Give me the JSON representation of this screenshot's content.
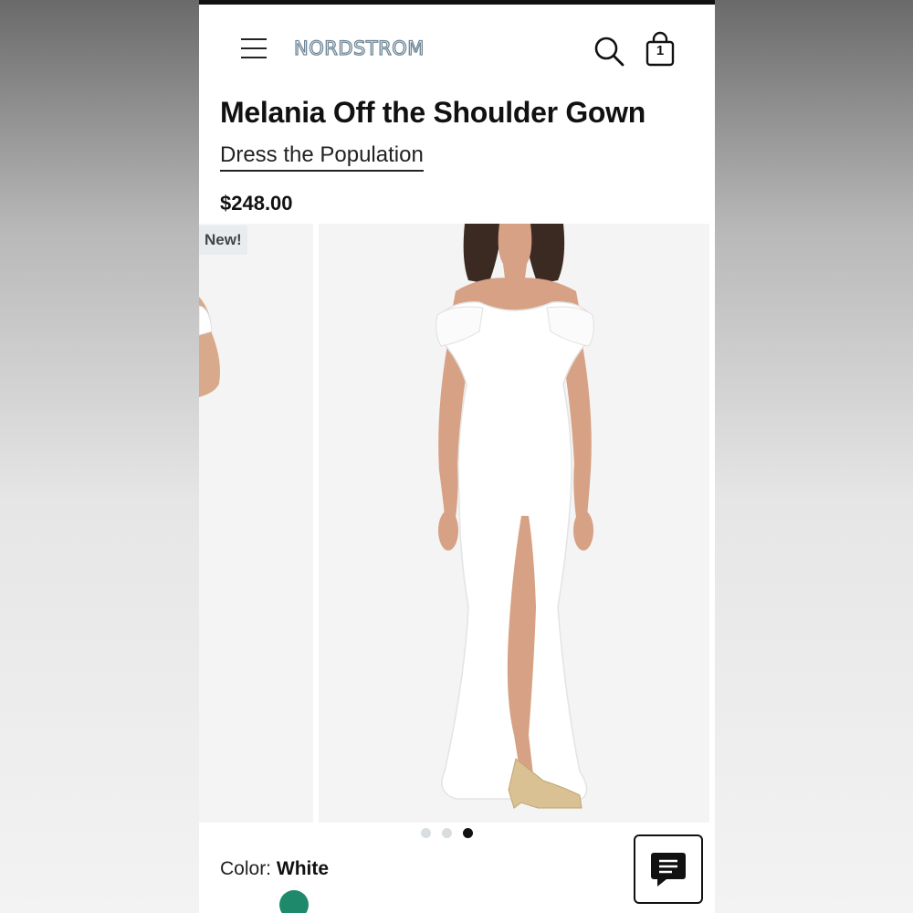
{
  "header": {
    "logo_text": "NORDSTROM",
    "menu_icon": "menu-icon",
    "search_icon": "search-icon",
    "bag_icon": "shopping-bag-icon",
    "bag_count": "1"
  },
  "product": {
    "title": "Melania Off the Shoulder Gown",
    "brand": "Dress the Population",
    "price": "$248.00"
  },
  "gallery": {
    "badge": "New!",
    "dot_count": 3,
    "active_index": 2
  },
  "color": {
    "label": "Color:",
    "value": "White",
    "swatch_color": "#1f8a6b"
  },
  "chat": {
    "icon": "chat-icon"
  }
}
